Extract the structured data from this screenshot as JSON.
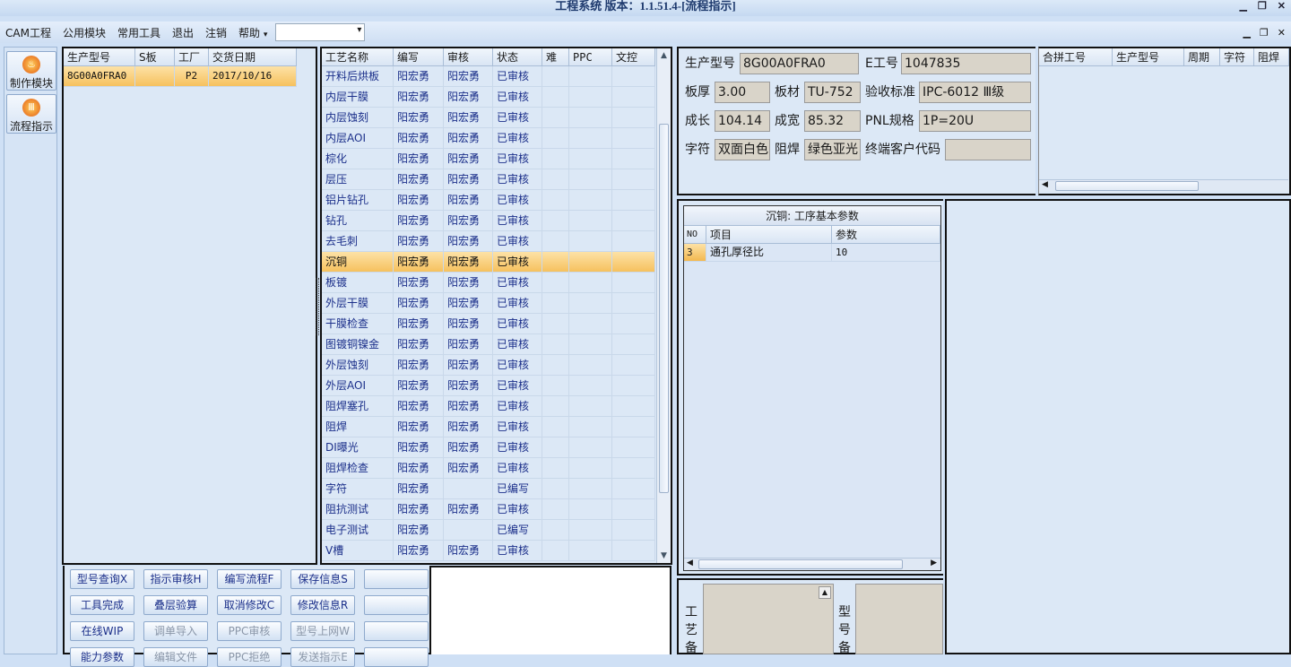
{
  "app": {
    "title": "工程系统 版本：1.1.51.4-[流程指示]"
  },
  "menu": [
    "CAM工程",
    "公用模块",
    "常用工具",
    "退出",
    "注销",
    "帮助"
  ],
  "menu_help_arrow": "▾",
  "tools": [
    {
      "label": "制作模块",
      "icon": "flame-icon"
    },
    {
      "label": "流程指示",
      "icon": "bars-icon"
    }
  ],
  "orders": {
    "headers": [
      "生产型号",
      "S板",
      "工厂",
      "交货日期"
    ],
    "rows": [
      [
        "8G00A0FRA0",
        "",
        "P2",
        "2017/10/16"
      ]
    ]
  },
  "process": {
    "headers": [
      "工艺名称",
      "编写",
      "审核",
      "状态",
      "难",
      "PPC",
      "文控"
    ],
    "selected_index": 9,
    "rows": [
      [
        "开料后烘板",
        "阳宏勇",
        "阳宏勇",
        "已审核"
      ],
      [
        "内层干膜",
        "阳宏勇",
        "阳宏勇",
        "已审核"
      ],
      [
        "内层蚀刻",
        "阳宏勇",
        "阳宏勇",
        "已审核"
      ],
      [
        "内层AOI",
        "阳宏勇",
        "阳宏勇",
        "已审核"
      ],
      [
        "棕化",
        "阳宏勇",
        "阳宏勇",
        "已审核"
      ],
      [
        "层压",
        "阳宏勇",
        "阳宏勇",
        "已审核"
      ],
      [
        "铝片钻孔",
        "阳宏勇",
        "阳宏勇",
        "已审核"
      ],
      [
        "钻孔",
        "阳宏勇",
        "阳宏勇",
        "已审核"
      ],
      [
        "去毛刺",
        "阳宏勇",
        "阳宏勇",
        "已审核"
      ],
      [
        "沉铜",
        "阳宏勇",
        "阳宏勇",
        "已审核"
      ],
      [
        "板镀",
        "阳宏勇",
        "阳宏勇",
        "已审核"
      ],
      [
        "外层干膜",
        "阳宏勇",
        "阳宏勇",
        "已审核"
      ],
      [
        "干膜检查",
        "阳宏勇",
        "阳宏勇",
        "已审核"
      ],
      [
        "图镀铜镍金",
        "阳宏勇",
        "阳宏勇",
        "已审核"
      ],
      [
        "外层蚀刻",
        "阳宏勇",
        "阳宏勇",
        "已审核"
      ],
      [
        "外层AOI",
        "阳宏勇",
        "阳宏勇",
        "已审核"
      ],
      [
        "阻焊塞孔",
        "阳宏勇",
        "阳宏勇",
        "已审核"
      ],
      [
        "阻焊",
        "阳宏勇",
        "阳宏勇",
        "已审核"
      ],
      [
        "DI曝光",
        "阳宏勇",
        "阳宏勇",
        "已审核"
      ],
      [
        "阻焊检查",
        "阳宏勇",
        "阳宏勇",
        "已审核"
      ],
      [
        "字符",
        "阳宏勇",
        "",
        "已编写"
      ],
      [
        "阻抗测试",
        "阳宏勇",
        "阳宏勇",
        "已审核"
      ],
      [
        "电子测试",
        "阳宏勇",
        "",
        "已编写"
      ],
      [
        "V槽",
        "阳宏勇",
        "阳宏勇",
        "已审核"
      ]
    ]
  },
  "buttons": [
    [
      "型号查询X",
      "指示审核H",
      "编写流程F",
      "保存信息S",
      ""
    ],
    [
      "工具完成",
      "叠层验算",
      "取消修改C",
      "修改信息R",
      ""
    ],
    [
      "在线WIP",
      "调单导入",
      "PPC审核",
      "型号上网W",
      ""
    ],
    [
      "能力参数",
      "编辑文件",
      "PPC拒绝",
      "发送指示E",
      ""
    ]
  ],
  "buttons_disabled": [
    [
      2,
      1
    ],
    [
      2,
      2
    ],
    [
      2,
      3
    ],
    [
      3,
      1
    ],
    [
      3,
      2
    ],
    [
      3,
      3
    ]
  ],
  "info": {
    "model_label": "生产型号",
    "model": "8G00A0FRA0",
    "eno_label": "E工号",
    "eno": "1047835",
    "thick_label": "板厚",
    "thick": "3.00",
    "mat_label": "板材",
    "mat": "TU-752",
    "std_label": "验收标准",
    "std": "IPC-6012 Ⅲ级",
    "len_label": "成长",
    "len": "104.14",
    "wid_label": "成宽",
    "wid": "85.32",
    "pnl_label": "PNL规格",
    "pnl": "1P=20U",
    "char_label": "字符",
    "char": "双面白色",
    "mask_label": "阻焊",
    "mask": "绿色亚光",
    "cust_label": "终端客户代码",
    "cust": ""
  },
  "merge": {
    "headers": [
      "合拼工号",
      "生产型号",
      "周期",
      "字符",
      "阻焊"
    ]
  },
  "params": {
    "title": "沉铜: 工序基本参数",
    "headers": [
      "NO",
      "项目",
      "参数"
    ],
    "rows": [
      [
        "3",
        "通孔厚径比",
        "10"
      ]
    ]
  },
  "remarks": {
    "process_label": [
      "工",
      "艺",
      "备"
    ],
    "model_label": [
      "型",
      "号",
      "备"
    ]
  }
}
